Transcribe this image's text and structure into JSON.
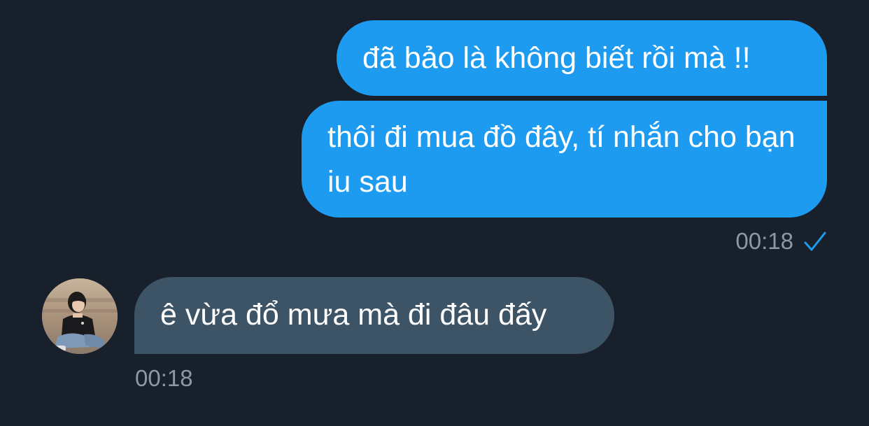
{
  "messages": [
    {
      "direction": "outgoing",
      "text": "đã bảo là không biết rồi mà !!"
    },
    {
      "direction": "outgoing",
      "text": "thôi đi mua đồ đây, tí nhắn cho bạn iu sau"
    },
    {
      "direction": "incoming",
      "text": "ê vừa đổ mưa mà đi đâu đấy"
    }
  ],
  "outgoing_time": "00:18",
  "outgoing_status_icon": "checkmark-icon",
  "incoming_time": "00:18",
  "incoming_avatar_icon": "avatar",
  "colors": {
    "background": "#18202b",
    "outgoing_bubble": "#1d9bf0",
    "incoming_bubble": "#3d5466",
    "timestamp": "#8b98a5",
    "check": "#1d9bf0"
  }
}
